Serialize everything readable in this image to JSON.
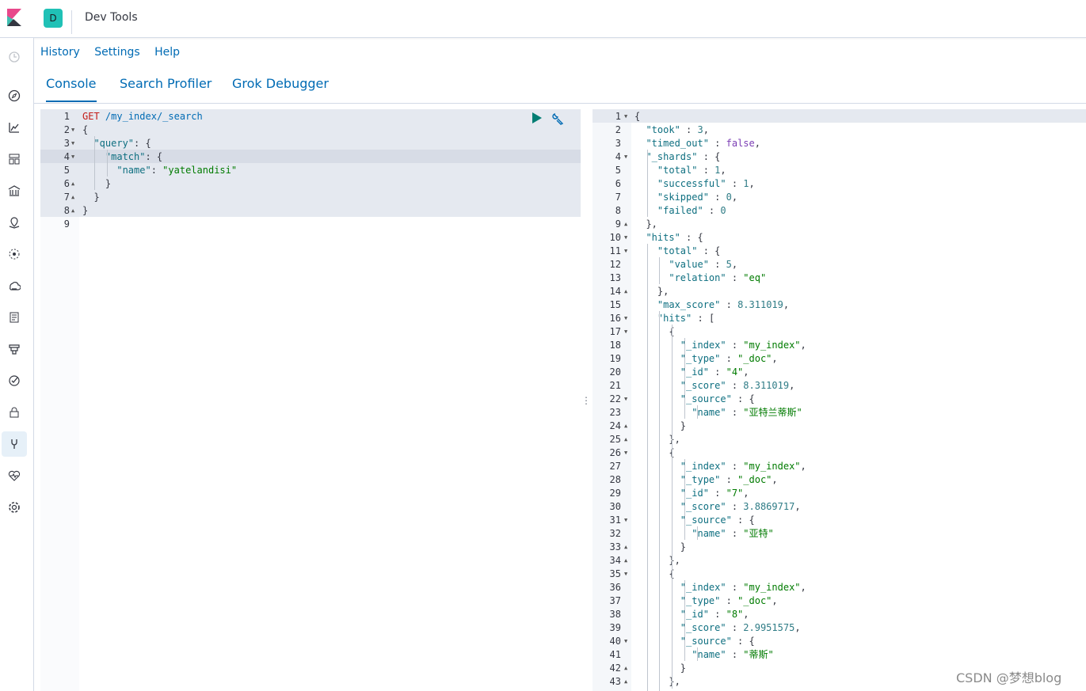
{
  "header": {
    "space_initial": "D",
    "app_title": "Dev Tools"
  },
  "sidebar": {
    "items": [
      {
        "icon": "clock-icon"
      },
      {
        "icon": "compass-icon"
      },
      {
        "icon": "visualize-icon"
      },
      {
        "icon": "dashboard-icon"
      },
      {
        "icon": "canvas-icon"
      },
      {
        "icon": "maps-icon"
      },
      {
        "icon": "ml-icon"
      },
      {
        "icon": "infra-icon"
      },
      {
        "icon": "logs-icon"
      },
      {
        "icon": "apm-icon"
      },
      {
        "icon": "uptime-icon"
      },
      {
        "icon": "siem-icon"
      },
      {
        "icon": "devtools-icon"
      },
      {
        "icon": "monitoring-icon"
      },
      {
        "icon": "gear-icon"
      }
    ]
  },
  "topnav": {
    "history": "History",
    "settings": "Settings",
    "help": "Help"
  },
  "tabs": {
    "console": "Console",
    "search_profiler": "Search Profiler",
    "grok_debugger": "Grok Debugger"
  },
  "request": {
    "lines": [
      {
        "n": "1",
        "t": "GET /my_index/_search"
      },
      {
        "n": "2",
        "t": "{"
      },
      {
        "n": "3",
        "t": "  \"query\": {"
      },
      {
        "n": "4",
        "t": "    \"match\": {"
      },
      {
        "n": "5",
        "t": "      \"name\": \"yatelandisi\""
      },
      {
        "n": "6",
        "t": "    }"
      },
      {
        "n": "7",
        "t": "  }"
      },
      {
        "n": "8",
        "t": "}"
      },
      {
        "n": "9",
        "t": ""
      }
    ]
  },
  "response": {
    "lines": [
      {
        "n": "1",
        "t": "{"
      },
      {
        "n": "2",
        "t": "  \"took\" : 3,"
      },
      {
        "n": "3",
        "t": "  \"timed_out\" : false,"
      },
      {
        "n": "4",
        "t": "  \"_shards\" : {"
      },
      {
        "n": "5",
        "t": "    \"total\" : 1,"
      },
      {
        "n": "6",
        "t": "    \"successful\" : 1,"
      },
      {
        "n": "7",
        "t": "    \"skipped\" : 0,"
      },
      {
        "n": "8",
        "t": "    \"failed\" : 0"
      },
      {
        "n": "9",
        "t": "  },"
      },
      {
        "n": "10",
        "t": "  \"hits\" : {"
      },
      {
        "n": "11",
        "t": "    \"total\" : {"
      },
      {
        "n": "12",
        "t": "      \"value\" : 5,"
      },
      {
        "n": "13",
        "t": "      \"relation\" : \"eq\""
      },
      {
        "n": "14",
        "t": "    },"
      },
      {
        "n": "15",
        "t": "    \"max_score\" : 8.311019,"
      },
      {
        "n": "16",
        "t": "    \"hits\" : ["
      },
      {
        "n": "17",
        "t": "      {"
      },
      {
        "n": "18",
        "t": "        \"_index\" : \"my_index\","
      },
      {
        "n": "19",
        "t": "        \"_type\" : \"_doc\","
      },
      {
        "n": "20",
        "t": "        \"_id\" : \"4\","
      },
      {
        "n": "21",
        "t": "        \"_score\" : 8.311019,"
      },
      {
        "n": "22",
        "t": "        \"_source\" : {"
      },
      {
        "n": "23",
        "t": "          \"name\" : \"亚特兰蒂斯\""
      },
      {
        "n": "24",
        "t": "        }"
      },
      {
        "n": "25",
        "t": "      },"
      },
      {
        "n": "26",
        "t": "      {"
      },
      {
        "n": "27",
        "t": "        \"_index\" : \"my_index\","
      },
      {
        "n": "28",
        "t": "        \"_type\" : \"_doc\","
      },
      {
        "n": "29",
        "t": "        \"_id\" : \"7\","
      },
      {
        "n": "30",
        "t": "        \"_score\" : 3.8869717,"
      },
      {
        "n": "31",
        "t": "        \"_source\" : {"
      },
      {
        "n": "32",
        "t": "          \"name\" : \"亚特\""
      },
      {
        "n": "33",
        "t": "        }"
      },
      {
        "n": "34",
        "t": "      },"
      },
      {
        "n": "35",
        "t": "      {"
      },
      {
        "n": "36",
        "t": "        \"_index\" : \"my_index\","
      },
      {
        "n": "37",
        "t": "        \"_type\" : \"_doc\","
      },
      {
        "n": "38",
        "t": "        \"_id\" : \"8\","
      },
      {
        "n": "39",
        "t": "        \"_score\" : 2.9951575,"
      },
      {
        "n": "40",
        "t": "        \"_source\" : {"
      },
      {
        "n": "41",
        "t": "          \"name\" : \"蒂斯\""
      },
      {
        "n": "42",
        "t": "        }"
      },
      {
        "n": "43",
        "t": "      },"
      }
    ]
  },
  "watermark": "CSDN @梦想blog",
  "colors": {
    "accent": "#006bb4",
    "teal": "#20c1b6",
    "run": "#017d73"
  }
}
